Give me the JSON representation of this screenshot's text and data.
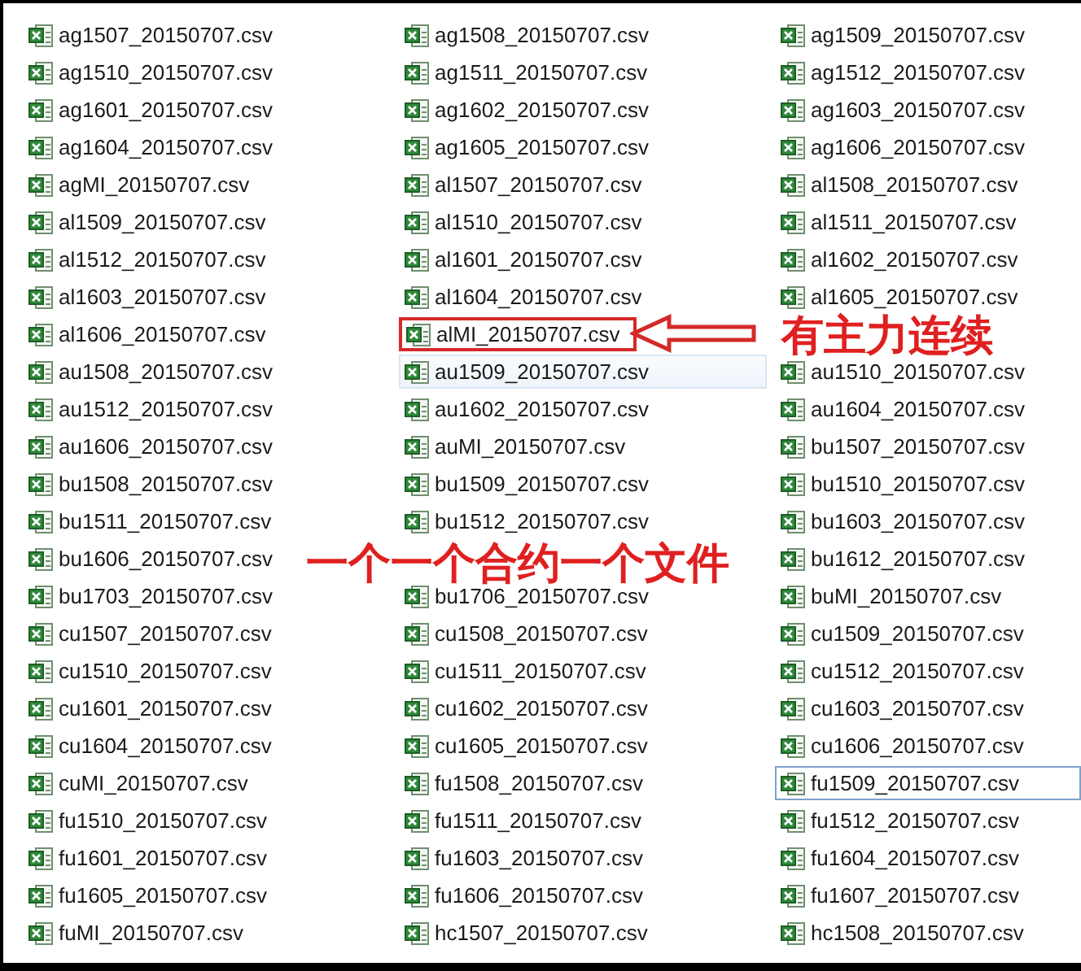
{
  "files": [
    {
      "kind": "file",
      "name": "ag1507_20150707.csv",
      "hovered": false,
      "focused": false
    },
    {
      "kind": "file",
      "name": "ag1508_20150707.csv",
      "hovered": false,
      "focused": false
    },
    {
      "kind": "file",
      "name": "ag1509_20150707.csv",
      "hovered": false,
      "focused": false
    },
    {
      "kind": "file",
      "name": "ag1510_20150707.csv",
      "hovered": false,
      "focused": false
    },
    {
      "kind": "file",
      "name": "ag1511_20150707.csv",
      "hovered": false,
      "focused": false
    },
    {
      "kind": "file",
      "name": "ag1512_20150707.csv",
      "hovered": false,
      "focused": false
    },
    {
      "kind": "file",
      "name": "ag1601_20150707.csv",
      "hovered": false,
      "focused": false
    },
    {
      "kind": "file",
      "name": "ag1602_20150707.csv",
      "hovered": false,
      "focused": false
    },
    {
      "kind": "file",
      "name": "ag1603_20150707.csv",
      "hovered": false,
      "focused": false
    },
    {
      "kind": "file",
      "name": "ag1604_20150707.csv",
      "hovered": false,
      "focused": false
    },
    {
      "kind": "file",
      "name": "ag1605_20150707.csv",
      "hovered": false,
      "focused": false
    },
    {
      "kind": "file",
      "name": "ag1606_20150707.csv",
      "hovered": false,
      "focused": false
    },
    {
      "kind": "file",
      "name": "agMI_20150707.csv",
      "hovered": false,
      "focused": false
    },
    {
      "kind": "file",
      "name": "al1507_20150707.csv",
      "hovered": false,
      "focused": false
    },
    {
      "kind": "file",
      "name": "al1508_20150707.csv",
      "hovered": false,
      "focused": false
    },
    {
      "kind": "file",
      "name": "al1509_20150707.csv",
      "hovered": false,
      "focused": false
    },
    {
      "kind": "file",
      "name": "al1510_20150707.csv",
      "hovered": false,
      "focused": false
    },
    {
      "kind": "file",
      "name": "al1511_20150707.csv",
      "hovered": false,
      "focused": false
    },
    {
      "kind": "file",
      "name": "al1512_20150707.csv",
      "hovered": false,
      "focused": false
    },
    {
      "kind": "file",
      "name": "al1601_20150707.csv",
      "hovered": false,
      "focused": false
    },
    {
      "kind": "file",
      "name": "al1602_20150707.csv",
      "hovered": false,
      "focused": false
    },
    {
      "kind": "file",
      "name": "al1603_20150707.csv",
      "hovered": false,
      "focused": false
    },
    {
      "kind": "file",
      "name": "al1604_20150707.csv",
      "hovered": false,
      "focused": false
    },
    {
      "kind": "file",
      "name": "al1605_20150707.csv",
      "hovered": false,
      "focused": false
    },
    {
      "kind": "file",
      "name": "al1606_20150707.csv",
      "hovered": false,
      "focused": false
    },
    {
      "kind": "file",
      "name": "alMI_20150707.csv",
      "hovered": false,
      "focused": false,
      "boxed": true
    },
    {
      "kind": "covered"
    },
    {
      "kind": "file",
      "name": "au1508_20150707.csv",
      "hovered": false,
      "focused": false
    },
    {
      "kind": "file",
      "name": "au1509_20150707.csv",
      "hovered": true,
      "focused": false
    },
    {
      "kind": "file",
      "name": "au1510_20150707.csv",
      "hovered": false,
      "focused": false
    },
    {
      "kind": "file",
      "name": "au1512_20150707.csv",
      "hovered": false,
      "focused": false
    },
    {
      "kind": "file",
      "name": "au1602_20150707.csv",
      "hovered": false,
      "focused": false
    },
    {
      "kind": "file",
      "name": "au1604_20150707.csv",
      "hovered": false,
      "focused": false
    },
    {
      "kind": "file",
      "name": "au1606_20150707.csv",
      "hovered": false,
      "focused": false
    },
    {
      "kind": "file",
      "name": "auMI_20150707.csv",
      "hovered": false,
      "focused": false
    },
    {
      "kind": "file",
      "name": "bu1507_20150707.csv",
      "hovered": false,
      "focused": false
    },
    {
      "kind": "file",
      "name": "bu1508_20150707.csv",
      "hovered": false,
      "focused": false
    },
    {
      "kind": "file",
      "name": "bu1509_20150707.csv",
      "hovered": false,
      "focused": false
    },
    {
      "kind": "file",
      "name": "bu1510_20150707.csv",
      "hovered": false,
      "focused": false
    },
    {
      "kind": "file",
      "name": "bu1511_20150707.csv",
      "hovered": false,
      "focused": false
    },
    {
      "kind": "file",
      "name": "bu1512_20150707.csv",
      "hovered": false,
      "focused": false
    },
    {
      "kind": "file",
      "name": "bu1603_20150707.csv",
      "hovered": false,
      "focused": false
    },
    {
      "kind": "file",
      "name": "bu1606_20150707.csv",
      "hovered": false,
      "focused": false
    },
    {
      "kind": "covered"
    },
    {
      "kind": "file",
      "name": "bu1612_20150707.csv",
      "hovered": false,
      "focused": false
    },
    {
      "kind": "file",
      "name": "bu1703_20150707.csv",
      "hovered": false,
      "focused": false
    },
    {
      "kind": "file",
      "name": "bu1706_20150707.csv",
      "hovered": false,
      "focused": false
    },
    {
      "kind": "file",
      "name": "buMI_20150707.csv",
      "hovered": false,
      "focused": false
    },
    {
      "kind": "file",
      "name": "cu1507_20150707.csv",
      "hovered": false,
      "focused": false
    },
    {
      "kind": "file",
      "name": "cu1508_20150707.csv",
      "hovered": false,
      "focused": false
    },
    {
      "kind": "file",
      "name": "cu1509_20150707.csv",
      "hovered": false,
      "focused": false
    },
    {
      "kind": "file",
      "name": "cu1510_20150707.csv",
      "hovered": false,
      "focused": false
    },
    {
      "kind": "file",
      "name": "cu1511_20150707.csv",
      "hovered": false,
      "focused": false
    },
    {
      "kind": "file",
      "name": "cu1512_20150707.csv",
      "hovered": false,
      "focused": false
    },
    {
      "kind": "file",
      "name": "cu1601_20150707.csv",
      "hovered": false,
      "focused": false
    },
    {
      "kind": "file",
      "name": "cu1602_20150707.csv",
      "hovered": false,
      "focused": false
    },
    {
      "kind": "file",
      "name": "cu1603_20150707.csv",
      "hovered": false,
      "focused": false
    },
    {
      "kind": "file",
      "name": "cu1604_20150707.csv",
      "hovered": false,
      "focused": false
    },
    {
      "kind": "file",
      "name": "cu1605_20150707.csv",
      "hovered": false,
      "focused": false
    },
    {
      "kind": "file",
      "name": "cu1606_20150707.csv",
      "hovered": false,
      "focused": false
    },
    {
      "kind": "file",
      "name": "cuMI_20150707.csv",
      "hovered": false,
      "focused": false
    },
    {
      "kind": "file",
      "name": "fu1508_20150707.csv",
      "hovered": false,
      "focused": false
    },
    {
      "kind": "file",
      "name": "fu1509_20150707.csv",
      "hovered": false,
      "focused": true
    },
    {
      "kind": "file",
      "name": "fu1510_20150707.csv",
      "hovered": false,
      "focused": false
    },
    {
      "kind": "file",
      "name": "fu1511_20150707.csv",
      "hovered": false,
      "focused": false
    },
    {
      "kind": "file",
      "name": "fu1512_20150707.csv",
      "hovered": false,
      "focused": false
    },
    {
      "kind": "file",
      "name": "fu1601_20150707.csv",
      "hovered": false,
      "focused": false
    },
    {
      "kind": "file",
      "name": "fu1603_20150707.csv",
      "hovered": false,
      "focused": false
    },
    {
      "kind": "file",
      "name": "fu1604_20150707.csv",
      "hovered": false,
      "focused": false
    },
    {
      "kind": "file",
      "name": "fu1605_20150707.csv",
      "hovered": false,
      "focused": false
    },
    {
      "kind": "file",
      "name": "fu1606_20150707.csv",
      "hovered": false,
      "focused": false
    },
    {
      "kind": "file",
      "name": "fu1607_20150707.csv",
      "hovered": false,
      "focused": false
    },
    {
      "kind": "file",
      "name": "fuMI_20150707.csv",
      "hovered": false,
      "focused": false
    },
    {
      "kind": "file",
      "name": "hc1507_20150707.csv",
      "hovered": false,
      "focused": false
    },
    {
      "kind": "file",
      "name": "hc1508_20150707.csv",
      "hovered": false,
      "focused": false
    }
  ],
  "annotations": {
    "arrow_label": "有主力连续",
    "note": "一个一个合约一个文件"
  }
}
